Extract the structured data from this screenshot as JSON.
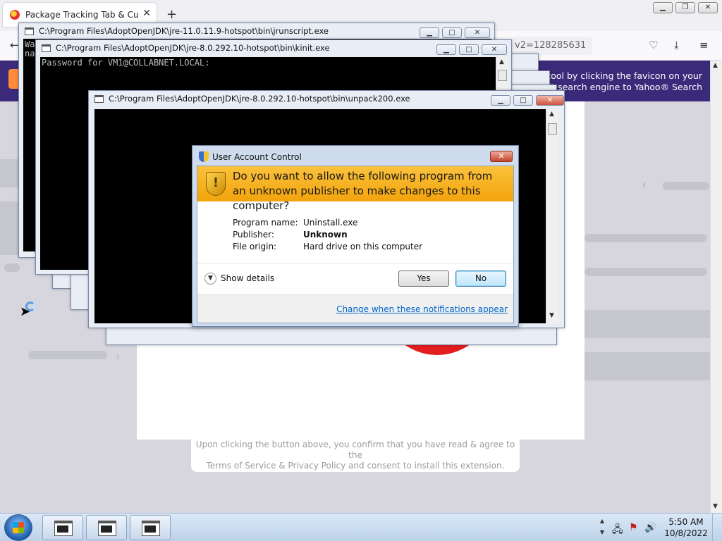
{
  "browser": {
    "tab_title": "Package Tracking Tab & Custom",
    "tab_close": "✕",
    "new_tab": "+",
    "url_fragment": "v2=128285631",
    "notice_line1": "acking tool by clicking the favicon on your",
    "notice_line2": "default search engine to Yahoo® Search",
    "disclaimer_line1": "Upon clicking the button above, you confirm that you have read & agree to the",
    "disclaimer_line2": "Terms of Service & Privacy Policy and consent to install this extension.",
    "window_controls": {
      "minimize": "▁",
      "restore": "❐",
      "close": "✕"
    }
  },
  "consoles": [
    {
      "title": "C:\\Program Files\\AdoptOpenJDK\\jre-11.0.11.9-hotspot\\bin\\jrunscript.exe",
      "text": "Wa\nna"
    },
    {
      "title": "C:\\Program Files\\AdoptOpenJDK\\jre-8.0.292.10-hotspot\\bin\\kinit.exe",
      "text": "Password for VM1@COLLABNET.LOCAL:"
    },
    {
      "title": "C:\\Program Files\\AdoptOpenJDK\\jre-8.0.292.10-hotspot\\bin\\unpack200.exe",
      "text": ""
    }
  ],
  "uac": {
    "title": "User Account Control",
    "question": "Do you want to allow the following program from an unknown publisher to make changes to this computer?",
    "program_name_label": "Program name:",
    "program_name_value": "Uninstall.exe",
    "publisher_label": "Publisher:",
    "publisher_value": "Unknown",
    "file_origin_label": "File origin:",
    "file_origin_value": "Hard drive on this computer",
    "show_details": "Show details",
    "yes": "Yes",
    "no": "No",
    "change_link": "Change when these notifications appear"
  },
  "taskbar": {
    "time": "5:50 AM",
    "date": "10/8/2022"
  },
  "colors": {
    "uac_banner": "#f2a30c",
    "browser_header": "#3b2a7a",
    "red_logo": "#e41e1e"
  }
}
